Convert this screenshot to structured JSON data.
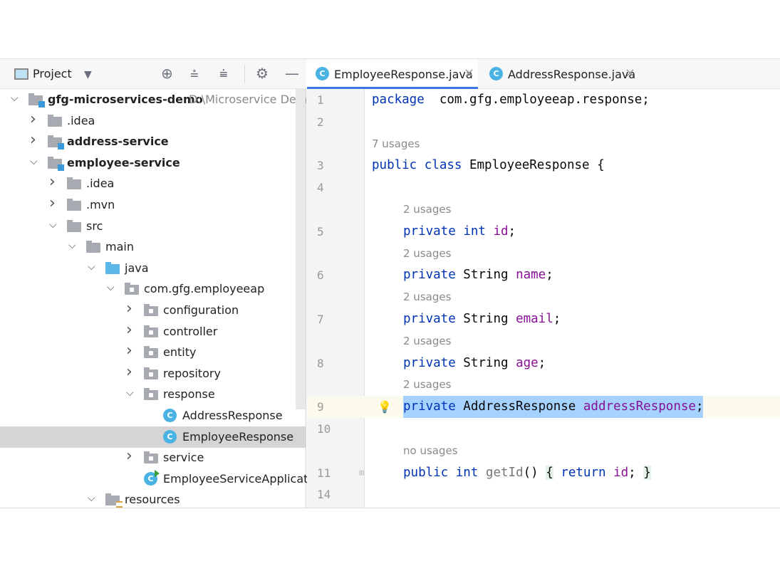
{
  "project_panel": {
    "title": "Project",
    "toolbar_icons": [
      "locate-icon",
      "expand-all-icon",
      "collapse-all-icon",
      "gear-icon",
      "minimize-icon"
    ],
    "tree": [
      {
        "label": "gfg-microservices-demo",
        "path": "D:\\Microservice Demo\\",
        "level": 0,
        "state": "expanded",
        "icon": "module",
        "bold": true
      },
      {
        "label": ".idea",
        "level": 1,
        "state": "collapsed",
        "icon": "folder"
      },
      {
        "label": "address-service",
        "level": 1,
        "state": "collapsed",
        "icon": "module",
        "bold": true
      },
      {
        "label": "employee-service",
        "level": 1,
        "state": "expanded",
        "icon": "module",
        "bold": true
      },
      {
        "label": ".idea",
        "level": 2,
        "state": "collapsed",
        "icon": "folder"
      },
      {
        "label": ".mvn",
        "level": 2,
        "state": "collapsed",
        "icon": "folder"
      },
      {
        "label": "src",
        "level": 2,
        "state": "expanded",
        "icon": "folder"
      },
      {
        "label": "main",
        "level": 3,
        "state": "expanded",
        "icon": "folder"
      },
      {
        "label": "java",
        "level": 4,
        "state": "expanded",
        "icon": "source-folder"
      },
      {
        "label": "com.gfg.employeeap",
        "level": 5,
        "state": "expanded",
        "icon": "package"
      },
      {
        "label": "configuration",
        "level": 6,
        "state": "collapsed",
        "icon": "package"
      },
      {
        "label": "controller",
        "level": 6,
        "state": "collapsed",
        "icon": "package"
      },
      {
        "label": "entity",
        "level": 6,
        "state": "collapsed",
        "icon": "package"
      },
      {
        "label": "repository",
        "level": 6,
        "state": "collapsed",
        "icon": "package"
      },
      {
        "label": "response",
        "level": 6,
        "state": "expanded",
        "icon": "package"
      },
      {
        "label": "AddressResponse",
        "level": 7,
        "state": "leaf",
        "icon": "class"
      },
      {
        "label": "EmployeeResponse",
        "level": 7,
        "state": "leaf",
        "icon": "class",
        "selected": true
      },
      {
        "label": "service",
        "level": 6,
        "state": "collapsed",
        "icon": "package"
      },
      {
        "label": "EmployeeServiceApplication",
        "level": 6,
        "state": "leaf",
        "icon": "spring-class"
      },
      {
        "label": "resources",
        "level": 4,
        "state": "expanded",
        "icon": "resources-folder"
      }
    ]
  },
  "tabs": [
    {
      "label": "EmployeeResponse.java",
      "active": true
    },
    {
      "label": "AddressResponse.java",
      "active": false
    }
  ],
  "editor": {
    "lines": [
      {
        "num": "1",
        "indent": 0,
        "tokens": [
          [
            "kw",
            "package"
          ],
          [
            "",
            "  com.gfg.employeeap.response;"
          ]
        ]
      },
      {
        "num": "2",
        "indent": 0,
        "tokens": []
      },
      {
        "hint": "7 usages",
        "indent": 0
      },
      {
        "num": "3",
        "indent": 0,
        "tokens": [
          [
            "kw",
            "public"
          ],
          [
            "",
            " "
          ],
          [
            "kw",
            "class"
          ],
          [
            "",
            " EmployeeResponse {"
          ]
        ]
      },
      {
        "num": "4",
        "indent": 0,
        "tokens": []
      },
      {
        "hint": "2 usages",
        "indent": 1
      },
      {
        "num": "5",
        "indent": 1,
        "tokens": [
          [
            "kw",
            "private"
          ],
          [
            "",
            " "
          ],
          [
            "kw",
            "int"
          ],
          [
            "",
            " "
          ],
          [
            "fld",
            "id"
          ],
          [
            "",
            ";"
          ]
        ]
      },
      {
        "hint": "2 usages",
        "indent": 1
      },
      {
        "num": "6",
        "indent": 1,
        "tokens": [
          [
            "kw",
            "private"
          ],
          [
            "",
            " String "
          ],
          [
            "fld",
            "name"
          ],
          [
            "",
            ";"
          ]
        ]
      },
      {
        "hint": "2 usages",
        "indent": 1
      },
      {
        "num": "7",
        "indent": 1,
        "tokens": [
          [
            "kw",
            "private"
          ],
          [
            "",
            " String "
          ],
          [
            "fld",
            "email"
          ],
          [
            "",
            ";"
          ]
        ]
      },
      {
        "hint": "2 usages",
        "indent": 1
      },
      {
        "num": "8",
        "indent": 1,
        "tokens": [
          [
            "kw",
            "private"
          ],
          [
            "",
            " String "
          ],
          [
            "fld",
            "age"
          ],
          [
            "",
            ";"
          ]
        ]
      },
      {
        "hint": "2 usages",
        "indent": 1
      },
      {
        "num": "9",
        "indent": 1,
        "current": true,
        "selected": true,
        "bulb": true,
        "tokens": [
          [
            "kw",
            "private"
          ],
          [
            "",
            " AddressResponse "
          ],
          [
            "fld",
            "addressResponse"
          ],
          [
            "",
            ";"
          ]
        ]
      },
      {
        "num": "10",
        "indent": 0,
        "tokens": []
      },
      {
        "hint": "no usages",
        "indent": 1
      },
      {
        "num": "11",
        "indent": 1,
        "fold": true,
        "tokens": [
          [
            "kw",
            "public"
          ],
          [
            "",
            " "
          ],
          [
            "kw",
            "int"
          ],
          [
            "",
            " "
          ],
          [
            "mth",
            "getId"
          ],
          [
            "",
            "() "
          ],
          [
            "brace",
            "{"
          ],
          [
            "",
            " "
          ],
          [
            "kw",
            "return"
          ],
          [
            "",
            " "
          ],
          [
            "fld",
            "id"
          ],
          [
            "",
            "; "
          ],
          [
            "brace",
            "}"
          ]
        ]
      },
      {
        "num": "14",
        "indent": 0,
        "tokens": []
      }
    ]
  },
  "colors": {
    "keyword": "#0033b3",
    "field": "#871094",
    "selection": "#a6d2ff",
    "accent": "#3b78e7"
  }
}
